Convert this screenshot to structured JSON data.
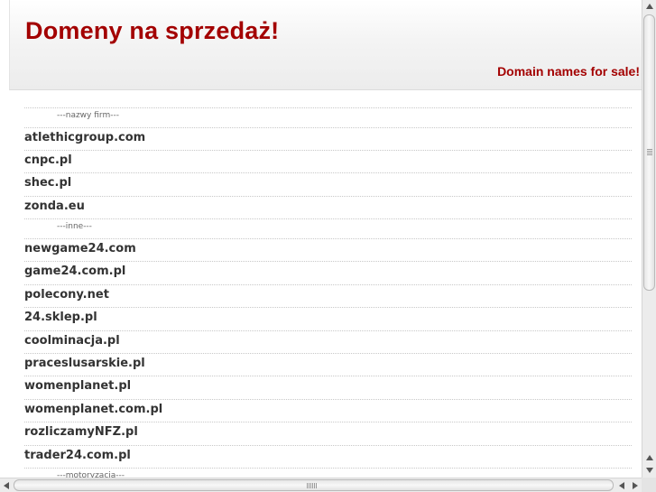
{
  "header": {
    "title": "Domeny na sprzedaż!",
    "subtitle": "Domain names for sale!"
  },
  "domains": [
    {
      "type": "category",
      "label": "---nazwy firm---"
    },
    {
      "type": "domain",
      "label": "atlethicgroup.com"
    },
    {
      "type": "domain",
      "label": "cnpc.pl"
    },
    {
      "type": "domain",
      "label": "shec.pl"
    },
    {
      "type": "domain",
      "label": "zonda.eu"
    },
    {
      "type": "category",
      "label": "---inne---"
    },
    {
      "type": "domain",
      "label": "newgame24.com"
    },
    {
      "type": "domain",
      "label": "game24.com.pl"
    },
    {
      "type": "domain",
      "label": "polecony.net"
    },
    {
      "type": "domain",
      "label": "24.sklep.pl"
    },
    {
      "type": "domain",
      "label": "coolminacja.pl"
    },
    {
      "type": "domain",
      "label": "praceslusarskie.pl"
    },
    {
      "type": "domain",
      "label": "womenplanet.pl"
    },
    {
      "type": "domain",
      "label": "womenplanet.com.pl"
    },
    {
      "type": "domain",
      "label": "rozliczamyNFZ.pl"
    },
    {
      "type": "domain",
      "label": "trader24.com.pl"
    },
    {
      "type": "category",
      "label": "---motoryzacja---"
    }
  ],
  "scrollbars": {
    "vertical_position": 0,
    "horizontal_position": 0
  },
  "colors": {
    "accent": "#a30000",
    "text": "#333333"
  }
}
